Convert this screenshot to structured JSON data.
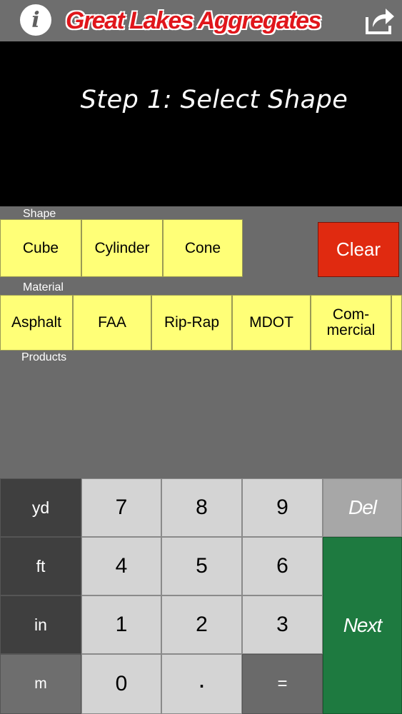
{
  "header": {
    "info_label": "i",
    "title": "Great Lakes Aggregates",
    "share_icon": "share-icon"
  },
  "banner": {
    "step_title": "Step 1: Select Shape"
  },
  "shape": {
    "label": "Shape",
    "buttons": [
      "Cube",
      "Cylinder",
      "Cone"
    ],
    "clear_label": "Clear"
  },
  "material": {
    "label": "Material",
    "buttons": [
      "Asphalt",
      "FAA",
      "Rip-Rap",
      "MDOT",
      "Com-\nmercial"
    ]
  },
  "products": {
    "label": "Products"
  },
  "keypad": {
    "units": [
      "yd",
      "ft",
      "in",
      "m"
    ],
    "digits": [
      "7",
      "8",
      "9",
      "4",
      "5",
      "6",
      "1",
      "2",
      "3",
      "0",
      "."
    ],
    "equals": "=",
    "del": "Del",
    "next": "Next"
  },
  "colors": {
    "title_red": "#e0161b",
    "button_yellow": "#ffff77",
    "clear_red": "#e02a10",
    "next_green": "#1e7a40"
  }
}
